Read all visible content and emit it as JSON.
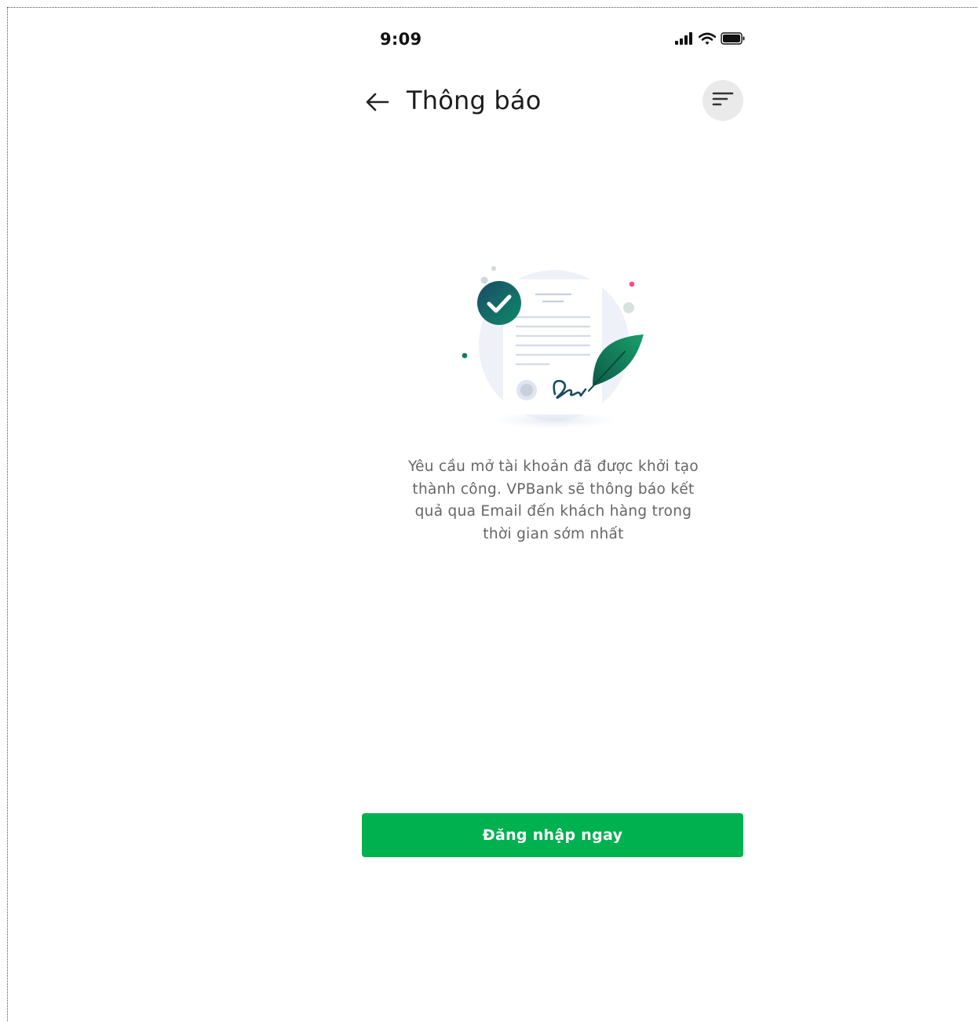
{
  "status_bar": {
    "time": "9:09",
    "icons": [
      "signal-icon",
      "wifi-icon",
      "battery-icon"
    ]
  },
  "header": {
    "back_icon": "arrow-left-icon",
    "title": "Thông báo",
    "filter_icon": "filter-icon"
  },
  "illustration": {
    "name": "document-signed-illustration",
    "icons": [
      "check-icon",
      "feather-icon",
      "seal-icon",
      "signature-icon"
    ]
  },
  "message": {
    "lines": [
      "Yêu cầu mở tài khoản đã được khởi tạo",
      "thành công. VPBank sẽ thông báo kết",
      "quả qua Email đến khách hàng trong",
      "thời gian sớm nhất"
    ]
  },
  "actions": {
    "login_label": "Đăng nhập ngay"
  },
  "colors": {
    "primary_green": "#00b14f",
    "check_dark": "#1a4a66",
    "check_teal": "#0f8a6a",
    "accent_pink": "#ff4d7d"
  }
}
